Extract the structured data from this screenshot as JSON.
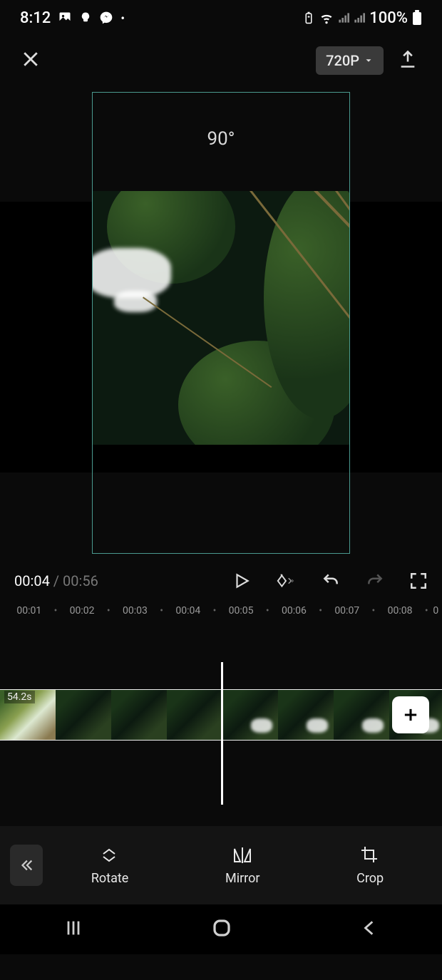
{
  "status": {
    "time": "8:12",
    "battery_pct": "100%"
  },
  "topbar": {
    "resolution": "720P"
  },
  "preview": {
    "rotation_label": "90°"
  },
  "transport": {
    "current": "00:04",
    "separator": " / ",
    "total": "00:56"
  },
  "ruler": {
    "ticks": [
      "00:01",
      "00:02",
      "00:03",
      "00:04",
      "00:05",
      "00:06",
      "00:07",
      "00:08",
      "0"
    ]
  },
  "timeline": {
    "clip_duration": "54.2s"
  },
  "tools": {
    "rotate": "Rotate",
    "mirror": "Mirror",
    "crop": "Crop"
  }
}
